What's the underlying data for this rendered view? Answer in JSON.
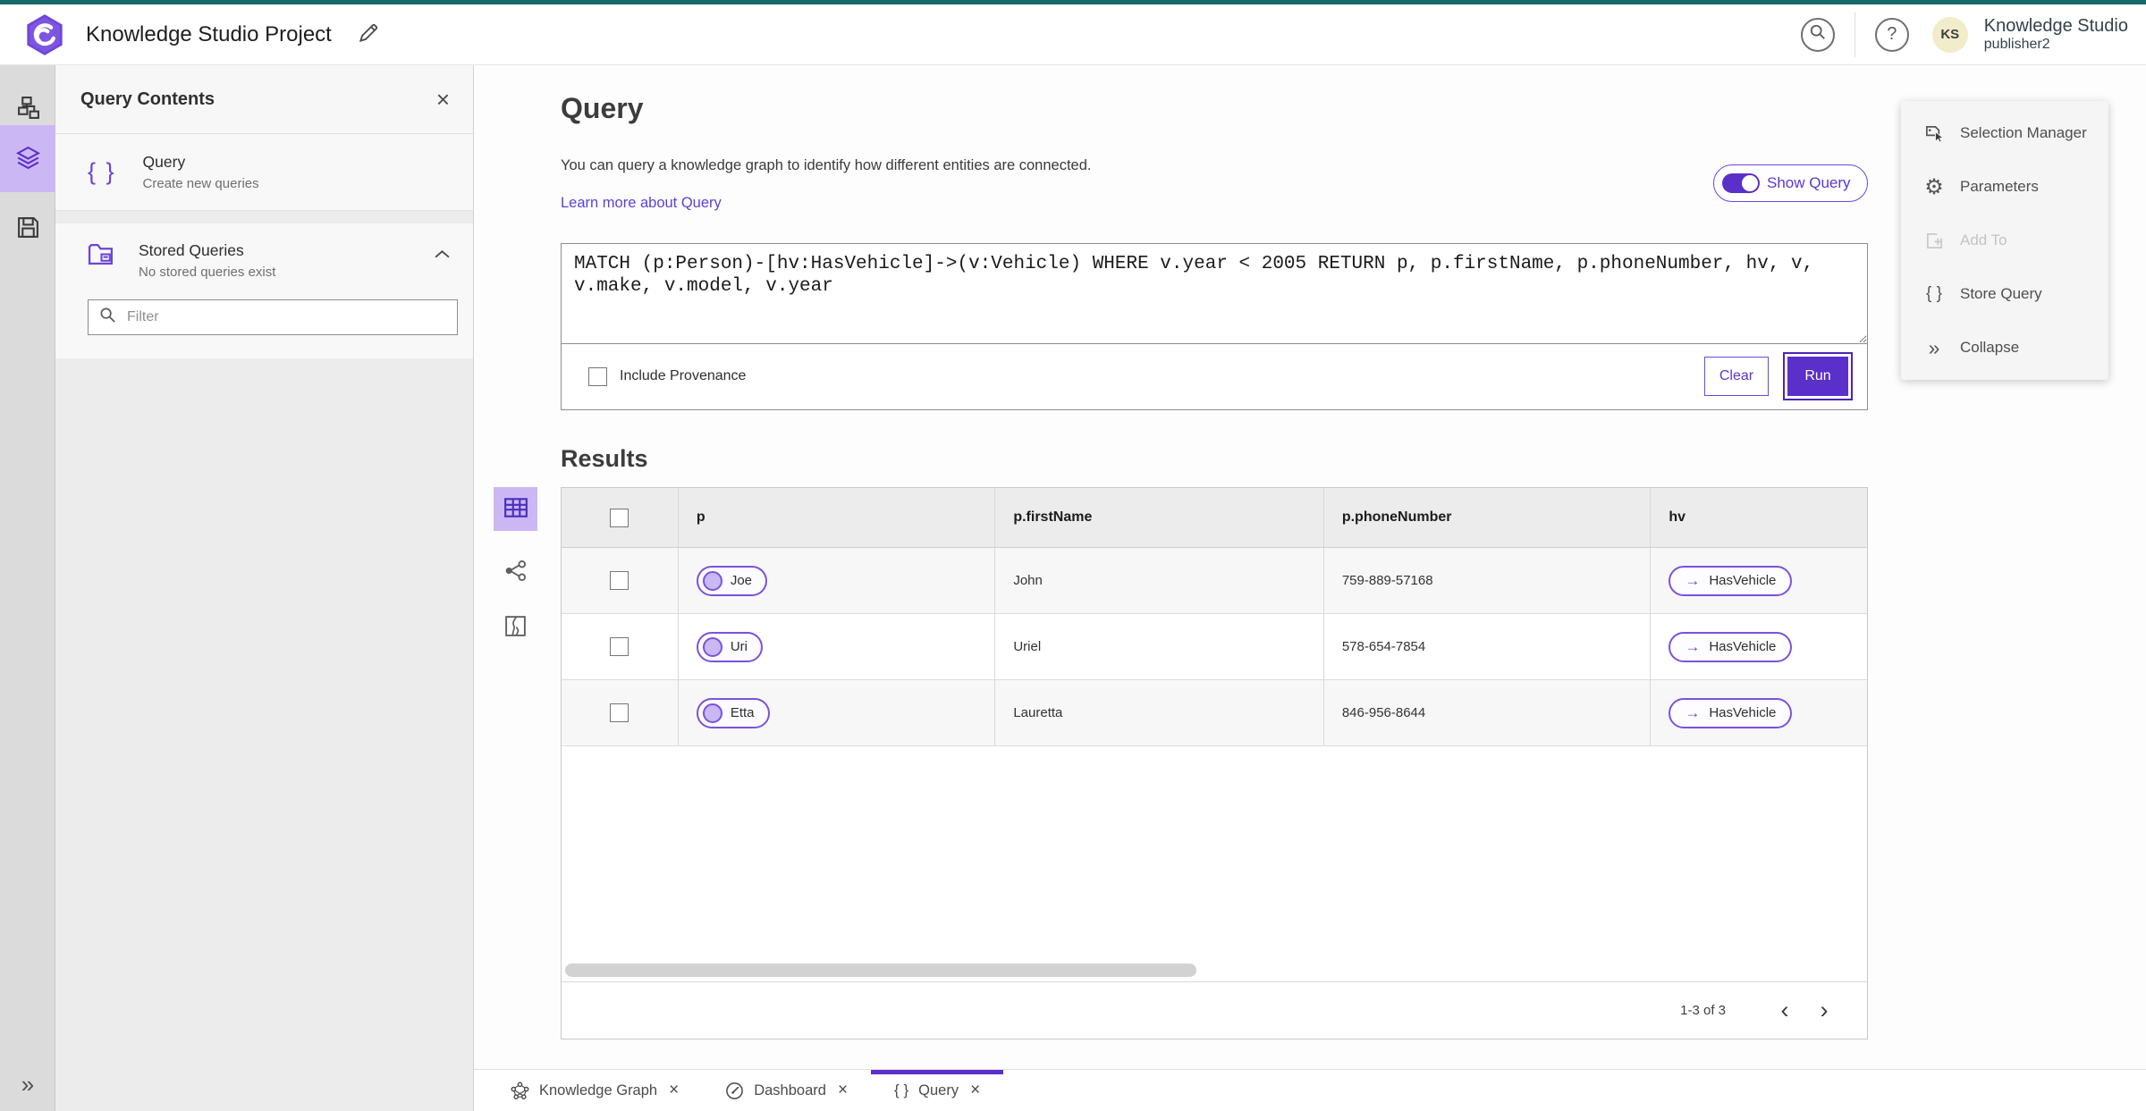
{
  "header": {
    "title": "Knowledge Studio Project",
    "product": "Knowledge Studio",
    "user": "publisher2",
    "avatar_initials": "KS"
  },
  "icons": {
    "help": "?",
    "close": "×",
    "collapse": "»",
    "expand": "»",
    "prev": "‹",
    "next": "›",
    "braces": "{ }",
    "gear": "⚙",
    "arrow_right": "→"
  },
  "colors": {
    "accent": "#5b2fc9",
    "accent_light": "#cbb7f4",
    "pill_border": "#7a52dd",
    "top_strip": "#17696b"
  },
  "side_panel": {
    "title": "Query Contents",
    "query_item": {
      "label": "Query",
      "sublabel": "Create new queries"
    },
    "stored_item": {
      "label": "Stored Queries",
      "sublabel": "No stored queries exist"
    },
    "filter_placeholder": "Filter"
  },
  "query_section": {
    "title": "Query",
    "description": "You can query a knowledge graph to identify how different entities are connected.",
    "link": "Learn more about Query",
    "show_query_label": "Show Query",
    "query_text": "MATCH (p:Person)-[hv:HasVehicle]->(v:Vehicle) WHERE v.year < 2005 RETURN p, p.firstName, p.phoneNumber, hv, v, v.make, v.model, v.year",
    "include_provenance_label": "Include Provenance",
    "clear_label": "Clear",
    "run_label": "Run"
  },
  "tools_menu": {
    "items": [
      {
        "label": "Selection Manager",
        "disabled": false
      },
      {
        "label": "Parameters",
        "disabled": false
      },
      {
        "label": "Add To",
        "disabled": true
      },
      {
        "label": "Store Query",
        "disabled": false
      },
      {
        "label": "Collapse",
        "disabled": false
      }
    ]
  },
  "results": {
    "title": "Results",
    "columns": {
      "c1": "p",
      "c2": "p.firstName",
      "c3": "p.phoneNumber",
      "c4": "hv"
    },
    "rows": [
      {
        "p": "Joe",
        "firstName": "John",
        "phoneNumber": "759-889-57168",
        "hv": "HasVehicle"
      },
      {
        "p": "Uri",
        "firstName": "Uriel",
        "phoneNumber": "578-654-7854",
        "hv": "HasVehicle"
      },
      {
        "p": "Etta",
        "firstName": "Lauretta",
        "phoneNumber": "846-956-8644",
        "hv": "HasVehicle"
      }
    ],
    "pagination": "1-3 of 3"
  },
  "tabs": {
    "items": [
      {
        "label": "Knowledge Graph"
      },
      {
        "label": "Dashboard"
      },
      {
        "label": "Query"
      }
    ]
  }
}
